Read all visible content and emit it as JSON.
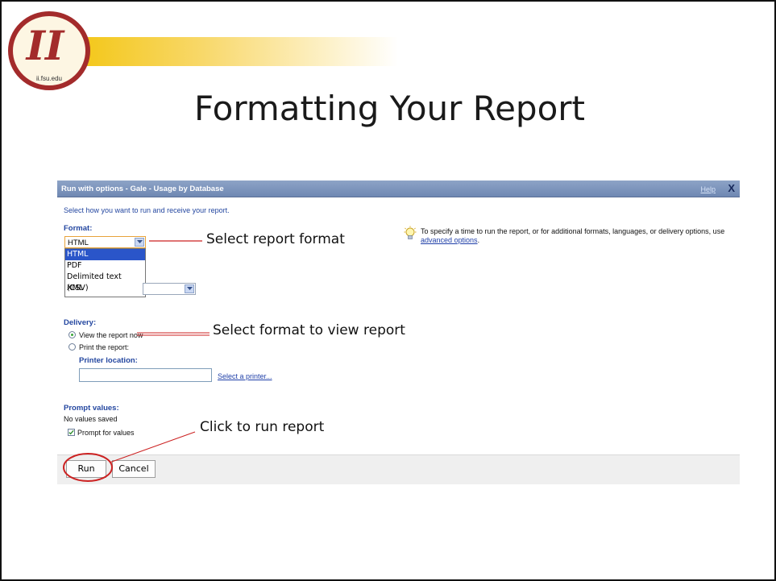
{
  "logo": {
    "text": "ii.fsu.edu",
    "letters": "II",
    "color": "#a32b2b"
  },
  "slide_title": "Formatting Your Report",
  "dialog": {
    "title": "Run with options - Gale - Usage by Database",
    "help_label": "Help",
    "close_icon": "close-icon",
    "instructions": "Select how you want to run and receive your report.",
    "format": {
      "label": "Format:",
      "selected": "HTML",
      "options": [
        "HTML",
        "PDF",
        "Delimited text (CSV)",
        "XML"
      ]
    },
    "tip": {
      "icon": "lightbulb-icon",
      "text": "To specify a time to run the report, or for additional formats, languages, or delivery options, use",
      "link": "advanced options",
      "link_suffix": "."
    },
    "delivery": {
      "label": "Delivery:",
      "options": [
        {
          "label": "View the report now",
          "selected": true
        },
        {
          "label": "Print the report:",
          "selected": false
        }
      ],
      "printer_location_label": "Printer location:",
      "printer_location_value": "",
      "select_printer_link": "Select a printer..."
    },
    "prompt": {
      "label": "Prompt values:",
      "status": "No values saved",
      "checkbox_label": "Prompt for values",
      "checked": true
    },
    "buttons": {
      "run": "Run",
      "cancel": "Cancel"
    }
  },
  "annotations": {
    "format_note": "Select report format",
    "view_note": "Select format to view report",
    "run_note": "Click to run report"
  },
  "colors": {
    "accent_red": "#cc2222",
    "titlebar": "#7e96bd",
    "link_blue": "#1f3fa8",
    "gold": "#f2c200"
  }
}
